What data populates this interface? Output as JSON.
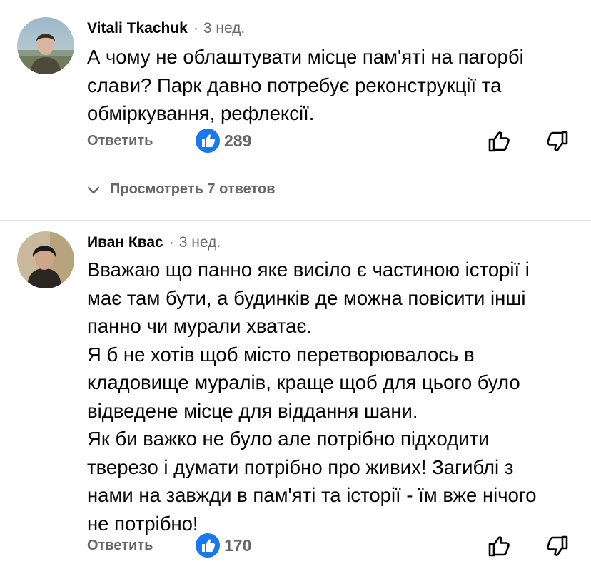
{
  "comments": [
    {
      "author": "Vitali Tkachuk",
      "separator": "·",
      "time": "3 нед.",
      "text_lines": [
        "А чому не облаштувати місце пам'яті на пагорбі",
        "слави? Парк давно потребує реконструкції та",
        "обміркування, рефлексії."
      ],
      "reply_label": "Ответить",
      "reaction_icon": "like-reaction-icon",
      "reaction_count": "289",
      "view_replies_label": "Просмотреть 7 ответов"
    },
    {
      "author": "Иван Квас",
      "separator": "·",
      "time": "3 нед.",
      "text_lines": [
        "Вважаю що панно яке висіло є частиною історії і",
        "має там бути, а будинків де можна повісити інші",
        "панно чи мурали хватає.",
        "Я б не хотів щоб місто перетворювалось в",
        "кладовище муралів, краще щоб для цього було",
        "відведене місце для віддання шани.",
        "Як би важко не було але потрібно підходити",
        "тверезо і думати потрібно про живих! Загиблі з",
        "нами на завжди в пам'яті та історії - їм вже нічого",
        "не потрібно!"
      ],
      "reply_label": "Ответить",
      "reaction_icon": "like-reaction-icon",
      "reaction_count": "170"
    }
  ],
  "icons": {
    "upvote": "thumbs-up-outline-icon",
    "downvote": "thumbs-down-outline-icon",
    "expand": "chevron-down-icon"
  },
  "colors": {
    "accent_blue": "#1877f2",
    "secondary_text": "#65676b",
    "primary_text": "#050505",
    "divider": "#e4e6eb"
  }
}
